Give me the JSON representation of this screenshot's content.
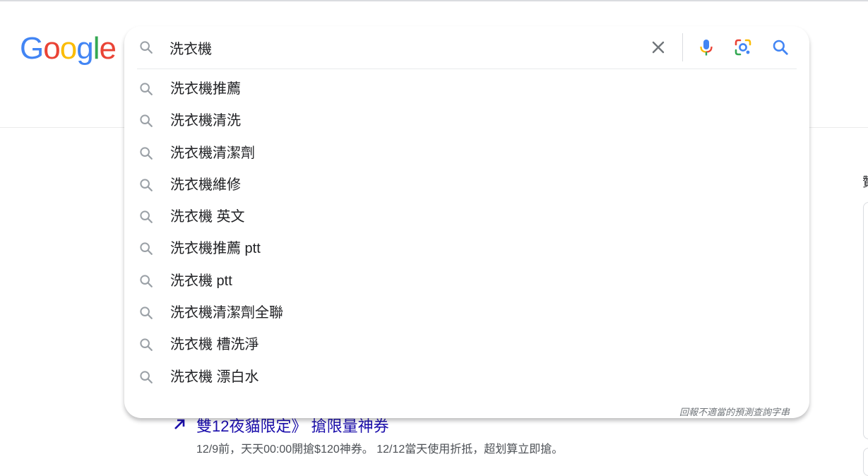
{
  "logo": {
    "letters": [
      "G",
      "o",
      "o",
      "g",
      "l",
      "e"
    ]
  },
  "search": {
    "query": "洗衣機",
    "clear_icon": "close-icon",
    "voice_icon": "microphone-icon",
    "lens_icon": "camera-lens-icon",
    "submit_icon": "search-icon"
  },
  "suggestions": [
    {
      "text": "洗衣機推薦"
    },
    {
      "text": "洗衣機清洗"
    },
    {
      "text": "洗衣機清潔劑"
    },
    {
      "text": "洗衣機維修"
    },
    {
      "text": "洗衣機 英文"
    },
    {
      "text": "洗衣機推薦 ptt"
    },
    {
      "text": "洗衣機 ptt"
    },
    {
      "text": "洗衣機清潔劑全聯"
    },
    {
      "text": "洗衣機 槽洗淨"
    },
    {
      "text": "洗衣機 漂白水"
    }
  ],
  "report_label": "回報不適當的預測查詢字串",
  "background": {
    "result_title": "雙12夜貓限定》 搶限量神券",
    "result_snippet": "12/9前，天天00:00開搶$120神券。 12/12當天使用折抵，超划算立即搶。",
    "side_text": "贊"
  },
  "colors": {
    "google_blue": "#4285f4",
    "google_red": "#ea4335",
    "google_yellow": "#fbbc05",
    "google_green": "#34a853",
    "link": "#1a0dab",
    "icon_gray": "#9aa0a6"
  }
}
